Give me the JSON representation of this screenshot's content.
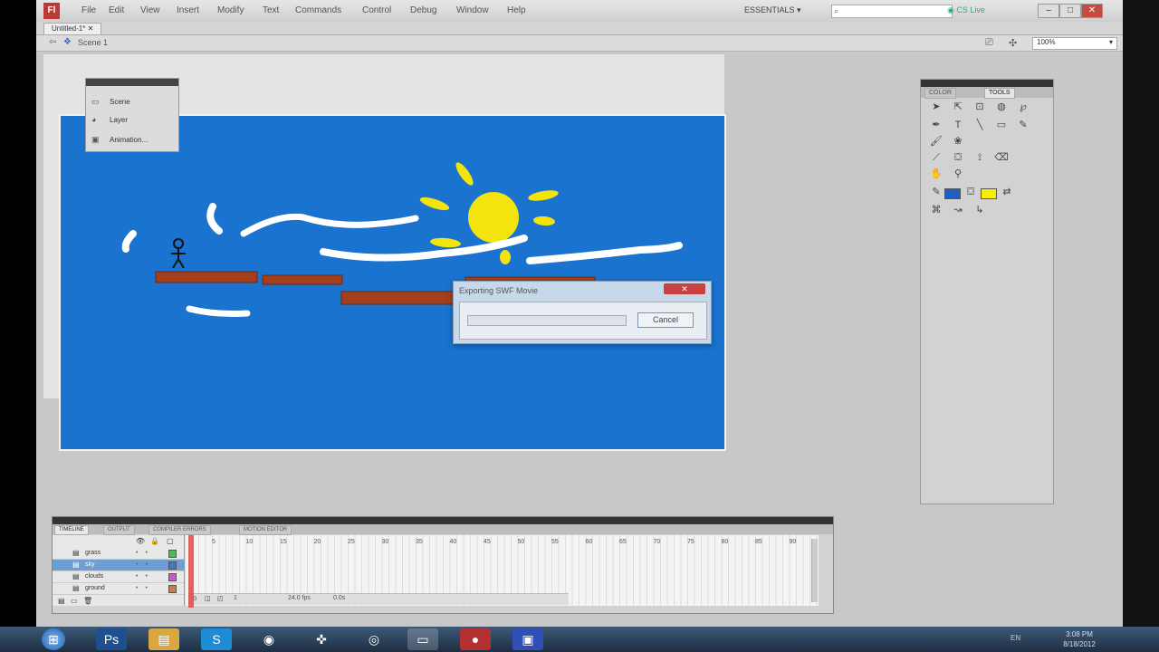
{
  "app": {
    "logo": "Fl"
  },
  "menu": [
    "File",
    "Edit",
    "View",
    "Insert",
    "Modify",
    "Text",
    "Commands",
    "Control",
    "Debug",
    "Window",
    "Help"
  ],
  "workspace": "ESSENTIALS",
  "search": {
    "placeholder": ""
  },
  "cslive": "CS Live",
  "window_controls": {
    "min": "–",
    "max": "□",
    "close": "✕"
  },
  "doc_tab": "Untitled-1*",
  "breadcrumb": "Scene 1",
  "zoom": "100%",
  "scenes_panel": {
    "items": [
      {
        "icon": "folder-icon",
        "label": "Scene"
      },
      {
        "icon": "globe-icon",
        "label": "Layer"
      },
      {
        "icon": "window-icon",
        "label": "Animation..."
      }
    ]
  },
  "dialog": {
    "title": "Exporting SWF Movie",
    "close_label": "✕",
    "cancel_label": "Cancel",
    "progress": 0.0
  },
  "tools_panel": {
    "tabs": [
      "COLOR",
      "TOOLS"
    ],
    "active_tab": "TOOLS",
    "stroke_color": "#1f5fc0",
    "fill_color": "#f5f000"
  },
  "timeline": {
    "tabs": [
      "TIMELINE",
      "OUTPUT",
      "COMPILER ERRORS",
      "MOTION EDITOR"
    ],
    "layers": [
      {
        "name": "grass",
        "color": "#4bbf4b",
        "selected": false
      },
      {
        "name": "sky",
        "color": "#3a79d0",
        "selected": true
      },
      {
        "name": "clouds",
        "color": "#c85ac8",
        "selected": false
      },
      {
        "name": "ground",
        "color": "#d67a2e",
        "selected": false
      }
    ],
    "frame_numbers": [
      "5",
      "10",
      "15",
      "20",
      "25",
      "30",
      "35",
      "40",
      "45",
      "50",
      "55",
      "60",
      "65",
      "70",
      "75",
      "80",
      "85",
      "90"
    ],
    "current_frame": "1",
    "fps": "24.0 fps",
    "time": "0.0s"
  },
  "taskbar": {
    "tray_lang": "EN",
    "clock_time": "3:08 PM",
    "clock_date": "8/18/2012"
  },
  "colors": {
    "stage_blue": "#1a73cf",
    "platform": "#a33f1c",
    "sun": "#f2e40c",
    "cloud": "#ffffff"
  }
}
